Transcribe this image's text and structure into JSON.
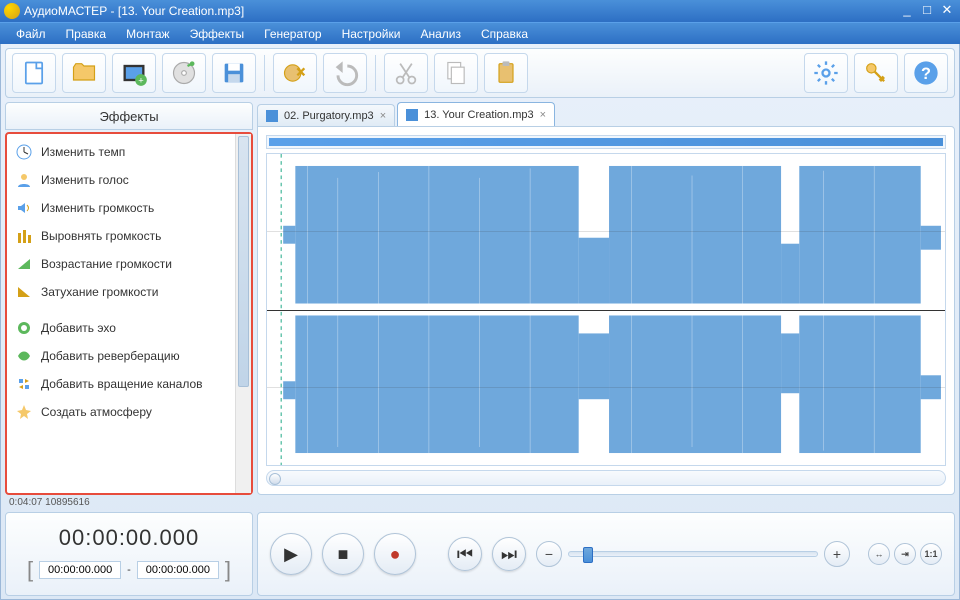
{
  "window": {
    "title": "АудиоМАСТЕР - [13. Your Creation.mp3]"
  },
  "menu": [
    "Файл",
    "Правка",
    "Монтаж",
    "Эффекты",
    "Генератор",
    "Настройки",
    "Анализ",
    "Справка"
  ],
  "sidebar": {
    "title": "Эффекты",
    "items": [
      {
        "label": "Изменить темп",
        "icon": "clock"
      },
      {
        "label": "Изменить голос",
        "icon": "person"
      },
      {
        "label": "Изменить громкость",
        "icon": "speaker"
      },
      {
        "label": "Выровнять громкость",
        "icon": "equalize"
      },
      {
        "label": "Возрастание громкости",
        "icon": "fadein"
      },
      {
        "label": "Затухание громкости",
        "icon": "fadeout"
      },
      {
        "label": "",
        "icon": ""
      },
      {
        "label": "Добавить эхо",
        "icon": "echo"
      },
      {
        "label": "Добавить реверберацию",
        "icon": "reverb"
      },
      {
        "label": "Добавить вращение каналов",
        "icon": "rotate"
      },
      {
        "label": "Создать атмосферу",
        "icon": "atmosphere"
      }
    ]
  },
  "tabs": [
    {
      "label": "02. Purgatory.mp3",
      "active": false
    },
    {
      "label": "13. Your Creation.mp3",
      "active": true
    }
  ],
  "status": "0:04:07 10895616",
  "time": {
    "big": "00:00:00.000",
    "sel_start": "00:00:00.000",
    "sel_end": "00:00:00.000",
    "sep": "-"
  },
  "zoom": {
    "fit_label": "1:1"
  }
}
